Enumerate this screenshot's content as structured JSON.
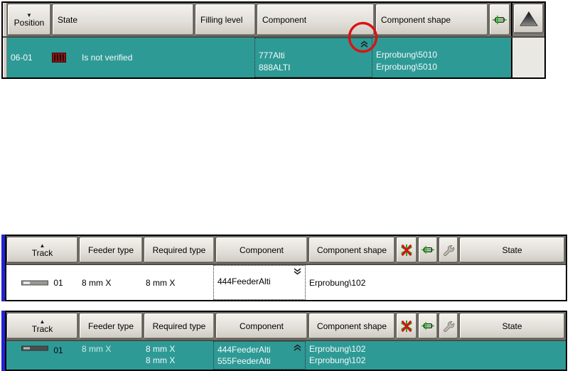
{
  "colors": {
    "selection_teal": "#2e9a96",
    "annotation_red": "#dc1212",
    "accent_blue_stripe": "#2323d6",
    "icon_green": "#12b412",
    "icon_red": "#d41414",
    "barcode_red": "#8c1616"
  },
  "icons": {
    "sort_descending": "▼",
    "sort_ascending": "▲",
    "scroll_up": "scroll-up-triangle",
    "collapse_rows": "chevron-double-up",
    "expand_rows": "chevron-double-down",
    "feeder": "feeder-green-cross",
    "delete_feeder": "red-x-green-asterisk",
    "setup_wrench": "wrench",
    "not_verified_barcode": "barcode",
    "track_feeder_bar": "feeder-bar"
  },
  "annotation": {
    "shape": "red-circle",
    "meaning": "highlights collapse chevron of component cell"
  },
  "panel_top": {
    "headers": {
      "position": "Position",
      "state": "State",
      "filling_level": "Filling level",
      "component": "Component",
      "component_shape": "Component shape"
    },
    "row": {
      "position": "06-01",
      "state": "Is not verified",
      "filling_level": "",
      "component_1": "777Alti",
      "component_2": "888ALTI",
      "shape_1": "Erprobung\\5010",
      "shape_2": "Erprobung\\5010"
    }
  },
  "panel_mid": {
    "headers": {
      "track": "Track",
      "feeder_type": "Feeder type",
      "required_type": "Required type",
      "component": "Component",
      "component_shape": "Component shape",
      "state": "State"
    },
    "row": {
      "track": "01",
      "feeder_type": "8 mm X",
      "required_type_1": "8 mm X",
      "component_1": "444FeederAlti",
      "shape_1": "Erprobung\\102",
      "state": ""
    }
  },
  "panel_bottom": {
    "headers": {
      "track": "Track",
      "feeder_type": "Feeder type",
      "required_type": "Required type",
      "component": "Component",
      "component_shape": "Component shape",
      "state": "State"
    },
    "row": {
      "track": "01",
      "feeder_type": "8 mm X",
      "required_type_1": "8 mm X",
      "required_type_2": "8 mm X",
      "component_1": "444FeederAlti",
      "component_2": "555FeederAlti",
      "shape_1": "Erprobung\\102",
      "shape_2": "Erprobung\\102",
      "state": ""
    }
  }
}
